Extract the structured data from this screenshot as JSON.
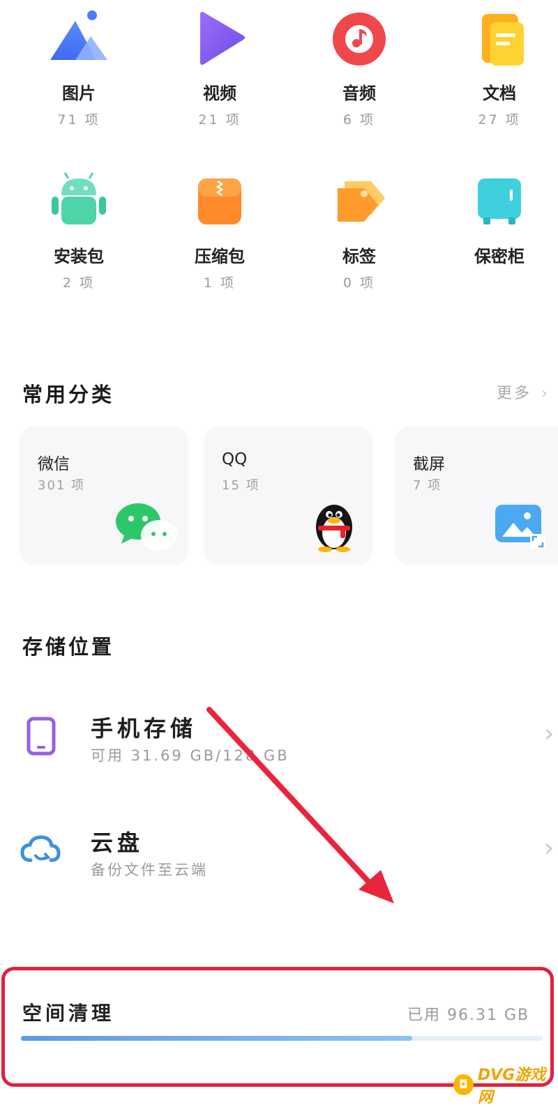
{
  "categories": [
    {
      "name": "图片",
      "count": "71 项",
      "icon": "image-icon"
    },
    {
      "name": "视频",
      "count": "21 项",
      "icon": "video-icon"
    },
    {
      "name": "音频",
      "count": "6 项",
      "icon": "music-icon"
    },
    {
      "name": "文档",
      "count": "27 项",
      "icon": "document-icon"
    },
    {
      "name": "安装包",
      "count": "2 项",
      "icon": "android-icon"
    },
    {
      "name": "压缩包",
      "count": "1 项",
      "icon": "zip-icon"
    },
    {
      "name": "标签",
      "count": "0 项",
      "icon": "tag-icon"
    },
    {
      "name": "保密柜",
      "count": "",
      "icon": "safe-icon"
    }
  ],
  "common": {
    "title": "常用分类",
    "more": "更多",
    "cards": [
      {
        "name": "微信",
        "count": "301 项",
        "icon": "wechat-icon"
      },
      {
        "name": "QQ",
        "count": "15 项",
        "icon": "qq-penguin-icon"
      },
      {
        "name": "截屏",
        "count": "7 项",
        "icon": "screenshot-icon"
      }
    ]
  },
  "storage": {
    "title": "存储位置",
    "phone": {
      "title": "手机存储",
      "sub": "可用 31.69 GB/128 GB",
      "icon": "phone-icon"
    },
    "cloud": {
      "title": "云盘",
      "sub": "备份文件至云端",
      "icon": "cloud-sync-icon"
    }
  },
  "cleanup": {
    "title": "空间清理",
    "used": "已用 96.31 GB",
    "used_fraction": 0.75
  },
  "watermark": {
    "text": "DVG游戏网"
  },
  "colors": {
    "highlight": "#e0213c",
    "arrow": "#e8253c",
    "progress": "#6fa8e6"
  }
}
